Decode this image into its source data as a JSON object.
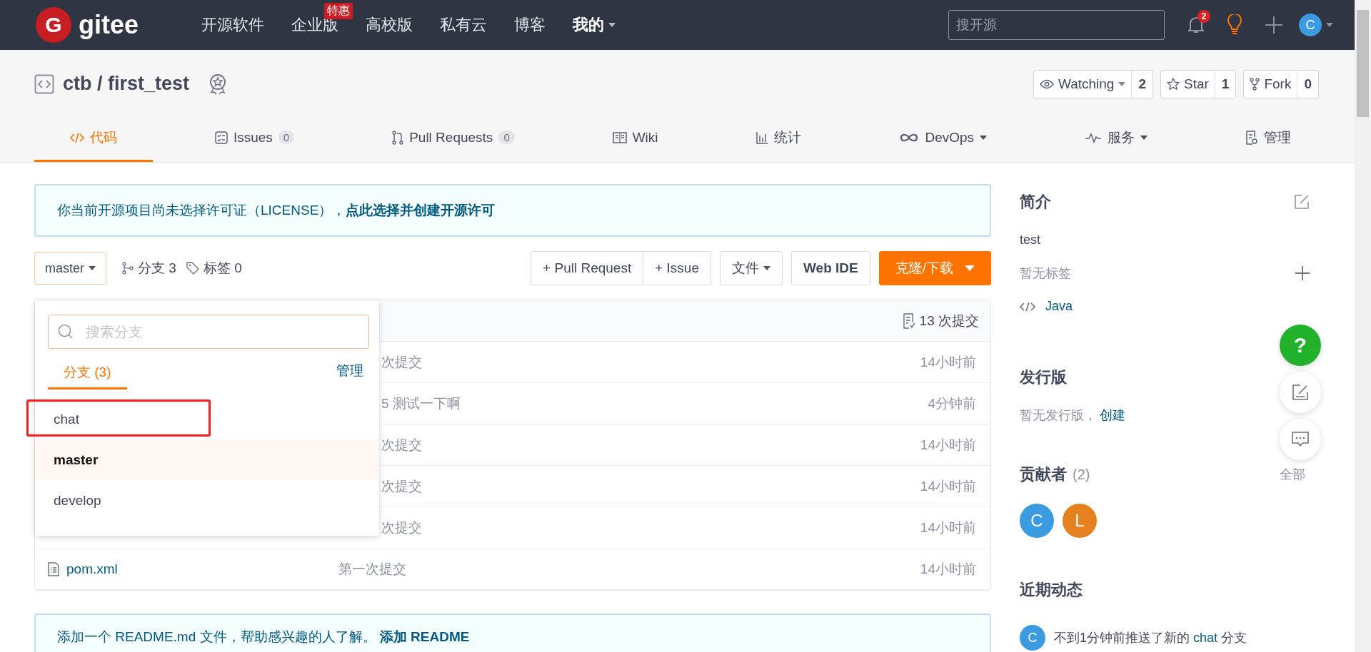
{
  "header": {
    "logo_mark": "G",
    "logo_text": "gitee",
    "nav": [
      {
        "label": "开源软件",
        "selected": false
      },
      {
        "label": "企业版",
        "badge": "特惠",
        "selected": false
      },
      {
        "label": "高校版",
        "selected": false
      },
      {
        "label": "私有云",
        "selected": false
      },
      {
        "label": "博客",
        "selected": false
      },
      {
        "label": "我的",
        "selected": true
      }
    ],
    "search": {
      "placeholder": "搜开源"
    },
    "notification_count": "2",
    "avatar": "C"
  },
  "repo": {
    "title": "ctb / first_test",
    "actions": [
      {
        "label": "Watching",
        "count": "2"
      },
      {
        "label": "Star",
        "count": "1"
      },
      {
        "label": "Fork",
        "count": "0"
      }
    ],
    "tabs": [
      {
        "label": "代码",
        "selected": true
      },
      {
        "label": "Issues",
        "count": "0",
        "selected": false
      },
      {
        "label": "Pull Requests",
        "count": "0",
        "selected": false
      },
      {
        "label": "Wiki",
        "selected": false
      },
      {
        "label": "统计",
        "selected": false
      },
      {
        "label": "DevOps",
        "selected": false
      },
      {
        "label": "服务",
        "selected": false
      },
      {
        "label": "管理",
        "selected": false
      }
    ]
  },
  "license_notice": {
    "text": "你当前开源项目尚未选择许可证（LICENSE），",
    "link": "点此选择并创建开源许可"
  },
  "toolbar": {
    "branch": "master",
    "branches": "分支 3",
    "tags": "标签 0",
    "buttons": [
      "+ Pull Request",
      "+ Issue",
      "文件",
      "Web IDE",
      "克隆/下载"
    ]
  },
  "branch_menu": {
    "placeholder": "搜索分支",
    "tab": "分支 (3)",
    "manage": "管理",
    "items": [
      {
        "name": "chat",
        "selected": false,
        "highlighted": true
      },
      {
        "name": "master",
        "selected": true,
        "highlighted": false
      },
      {
        "name": "develop",
        "selected": false,
        "highlighted": false
      }
    ]
  },
  "files": {
    "commits": "13 次提交",
    "rows": [
      {
        "message": "次提交",
        "time": "14小时前"
      },
      {
        "message": "5 测试一下啊",
        "time": "4分钟前"
      },
      {
        "message": "次提交",
        "time": "14小时前"
      },
      {
        "message": "次提交",
        "time": "14小时前"
      },
      {
        "message": "次提交",
        "time": "14小时前"
      },
      {
        "file": "pom.xml",
        "message": "第一次提交",
        "time": "14小时前"
      }
    ]
  },
  "readme_notice": {
    "text": "添加一个 README.md 文件，帮助感兴趣的人了解。",
    "link": "添加 README"
  },
  "sidebar": {
    "intro_title": "简介",
    "description": "test",
    "no_tags": "暂无标签",
    "language": "Java",
    "releases_title": "发行版",
    "no_releases": "暂无发行版，",
    "create_link": "创建",
    "contributors_title": "贡献者",
    "contributors_count": "(2)",
    "all_link": "全部",
    "contributors": [
      {
        "initial": "C",
        "color": "#3a9be0"
      },
      {
        "initial": "L",
        "color": "#e5811f"
      }
    ],
    "activity_title": "近期动态",
    "activity": [
      {
        "avatar": "C",
        "text": "不到1分钟前推送了新的",
        "link": "chat",
        "suffix": "分支"
      }
    ]
  },
  "help_button": "?"
}
